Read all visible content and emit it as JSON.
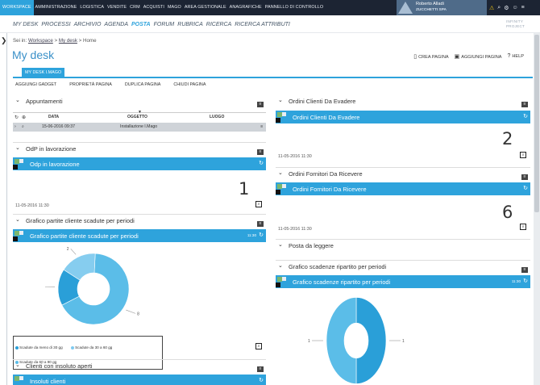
{
  "topbar": {
    "nav": [
      "WORKSPACE",
      "AMMINISTRAZIONE",
      "LOGISTICA",
      "VENDITE",
      "CRM",
      "ACQUISTI",
      "MAGO",
      "AREA GESTIONALE",
      "ANAGRAFICHE",
      "PANNELLO DI CONTROLLO"
    ],
    "user_name": "Roberto Alladi",
    "company": "ZUCCHETTI SPA"
  },
  "subnav": {
    "items": [
      "MY DESK",
      "PROCESSI",
      "ARCHIVIO",
      "AGENDA",
      "POSTA",
      "FORUM",
      "RUBRICA",
      "RICERCA",
      "RICERCA ATTRIBUTI"
    ],
    "brand_line1": "INFINITY",
    "brand_line2": "PROJECT"
  },
  "breadcrumb": {
    "prefix": "Sei in:",
    "workspace": "Workspace",
    "sep": ">",
    "mydesk": "My desk",
    "home": "Home"
  },
  "page_title": "My desk",
  "actions": {
    "create": "CREA PAGINA",
    "add": "AGGIUNGI PAGINA",
    "help": "HELP"
  },
  "tab": "MY DESK I.MAGO",
  "toolbar": [
    "AGGIUNGI GADGET",
    "PROPRIETÀ PAGINA",
    "DUPLICA PAGINA",
    "CHIUDI PAGINA"
  ],
  "left": {
    "appuntamenti": {
      "title": "Appuntamenti",
      "cols": [
        "DATA",
        "OGGETTO",
        "LUOGO"
      ],
      "row": {
        "data": "15-06-2016 09:37",
        "oggetto": "Installazione I.Mago"
      }
    },
    "odp": {
      "section_title": "OdP in lavorazione",
      "bar_title": "Odp in lavorazione",
      "count": "1",
      "timestamp": "11-05-2016 11:30"
    },
    "grafico": {
      "section_title": "Grafico partite cliente scadute per periodi",
      "bar_title": "Grafico partite cliente scadute per periodi",
      "time": "11:30",
      "legend": [
        "Scadute da meno di 30 gg",
        "Scadute da 30 a 60 gg",
        "Scadute da 60 a 90 gg"
      ]
    },
    "insoluti": {
      "section_title": "Clienti con insoluto aperti",
      "bar_title": "Insoluti clienti"
    }
  },
  "right": {
    "ordini_clienti": {
      "section_title": "Ordini Clienti Da Evadere",
      "bar_title": "Ordini Clienti Da Evadere",
      "count": "2",
      "timestamp": "11-05-2016 11:30"
    },
    "ordini_fornitori": {
      "section_title": "Ordini Fornitori Da Ricevere",
      "bar_title": "Ordini Fornitori Da Ricevere",
      "count": "6",
      "timestamp": "11-05-2016 11:30"
    },
    "posta": {
      "section_title": "Posta da leggere"
    },
    "grafico": {
      "section_title": "Grafico scadenze ripartito per periodi",
      "bar_title": "Grafico scadenze ripartito per periodi",
      "time": "11:30"
    }
  },
  "colors": {
    "accent": "#2ea3dc",
    "topbar": "#1c2433",
    "pie_light": "#5bbde8",
    "pie_dark": "#2a9fd8"
  },
  "chart_data": [
    {
      "type": "pie",
      "categories": [
        "Scadute da meno di 30 gg",
        "Scadute da 30 a 60 gg",
        "Scadute da 60 a 90 gg"
      ],
      "values": [
        8,
        2,
        2
      ],
      "donut": true
    },
    {
      "type": "pie",
      "categories": [
        "",
        "",
        ""
      ],
      "values": [
        1,
        1,
        0
      ],
      "labels": [
        "1",
        "1",
        "0"
      ],
      "donut": true
    }
  ]
}
